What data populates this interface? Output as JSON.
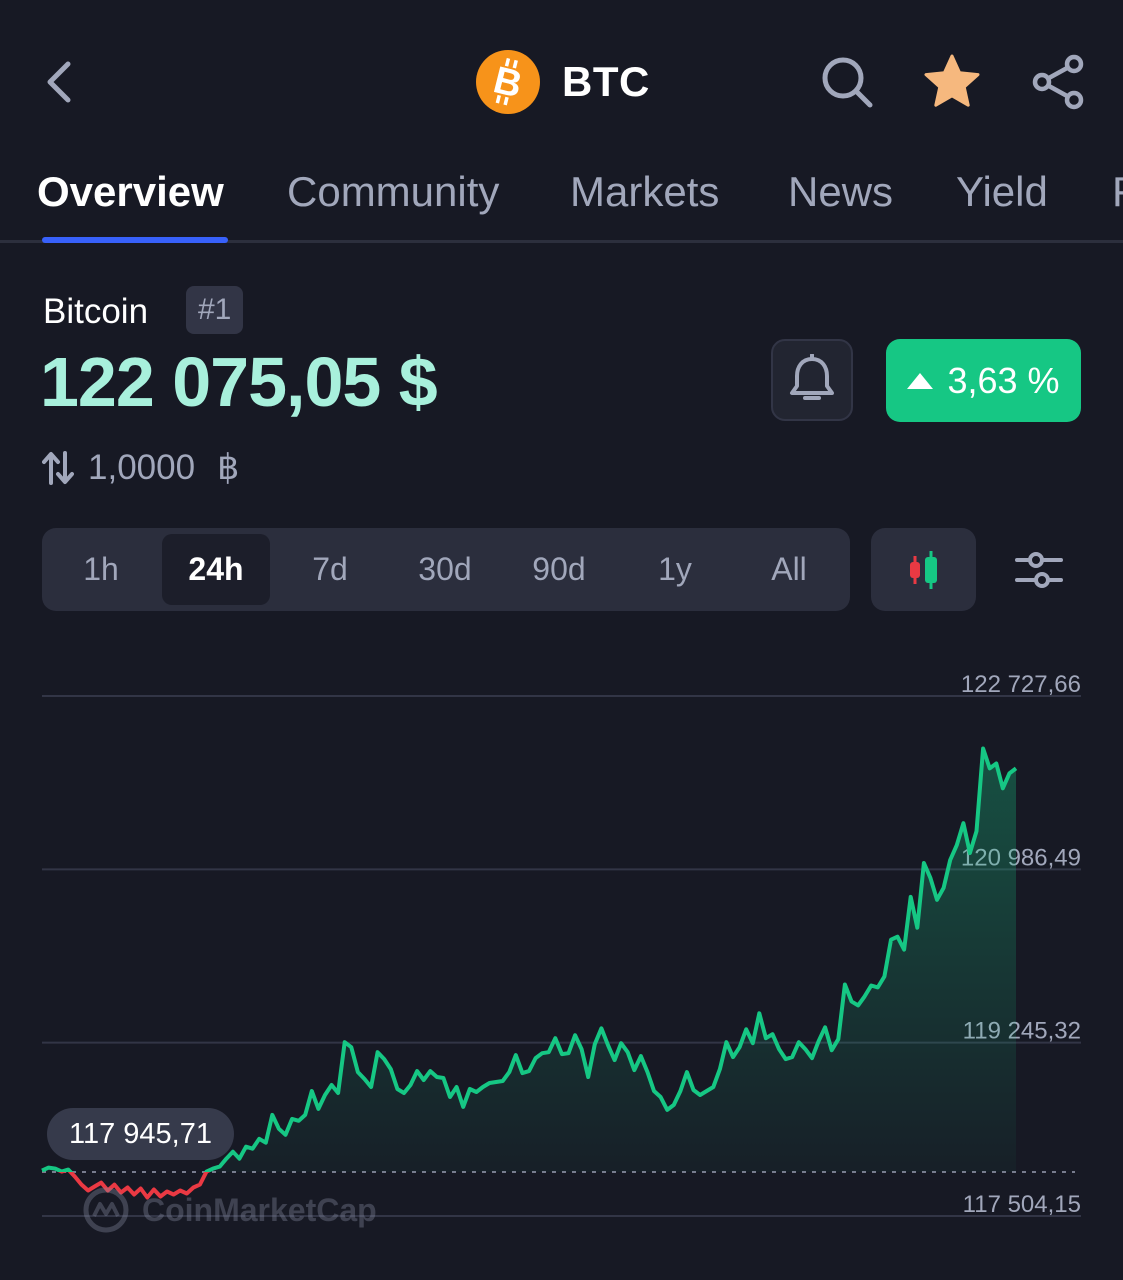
{
  "header": {
    "symbol": "BTC",
    "icons": {
      "back": "chevron-left-icon",
      "search": "search-icon",
      "favorite": "star-icon",
      "share": "share-icon"
    },
    "favorite_color": "#f6b87e",
    "logo_color": "#f7931a"
  },
  "tabs": [
    {
      "label": "Overview",
      "active": true
    },
    {
      "label": "Community",
      "active": false
    },
    {
      "label": "Markets",
      "active": false
    },
    {
      "label": "News",
      "active": false
    },
    {
      "label": "Yield",
      "active": false
    },
    {
      "label": "F",
      "active": false
    }
  ],
  "coin": {
    "name": "Bitcoin",
    "rank": "#1",
    "price": "122 075,05 $",
    "change": "3,63 %",
    "change_direction": "up",
    "change_color": "#16c784",
    "convert_amount": "1,0000",
    "convert_unit": "฿"
  },
  "ranges": [
    {
      "label": "1h",
      "active": false
    },
    {
      "label": "24h",
      "active": true
    },
    {
      "label": "7d",
      "active": false
    },
    {
      "label": "30d",
      "active": false
    },
    {
      "label": "90d",
      "active": false
    },
    {
      "label": "1y",
      "active": false
    },
    {
      "label": "All",
      "active": false
    }
  ],
  "chart": {
    "open_label": "117 945,71",
    "watermark": "CoinMarketCap"
  },
  "chart_data": {
    "type": "line",
    "title": "",
    "xlabel": "",
    "ylabel": "",
    "y_ticks": [
      "122 727,66",
      "120 986,49",
      "119 245,32",
      "117 504,15"
    ],
    "y_tick_values": [
      122727.66,
      120986.49,
      119245.32,
      117504.15
    ],
    "ylim": [
      117504.15,
      122727.66
    ],
    "baseline": 117945.71,
    "grid": true,
    "colors": {
      "up": "#16c784",
      "down": "#ea3943"
    },
    "series": [
      {
        "values": [
          117960,
          117990,
          117980,
          117950,
          117970,
          117900,
          117820,
          117760,
          117800,
          117840,
          117760,
          117820,
          117740,
          117790,
          117720,
          117780,
          117690,
          117770,
          117700,
          117750,
          117720,
          117760,
          117730,
          117790,
          117820,
          117950,
          117980,
          118000,
          118080,
          118150,
          118080,
          118200,
          118180,
          118280,
          118240,
          118520,
          118380,
          118320,
          118480,
          118460,
          118520,
          118760,
          118580,
          118720,
          118820,
          118740,
          119250,
          119200,
          118950,
          118880,
          118800,
          119150,
          119080,
          118980,
          118780,
          118740,
          118820,
          118960,
          118870,
          118960,
          118900,
          118890,
          118700,
          118800,
          118600,
          118780,
          118750,
          118800,
          118840,
          118850,
          118860,
          118950,
          119120,
          118940,
          118960,
          119090,
          119140,
          119150,
          119290,
          119130,
          119140,
          119320,
          119180,
          118900,
          119230,
          119390,
          119220,
          119070,
          119240,
          119150,
          118970,
          119110,
          118950,
          118760,
          118700,
          118570,
          118620,
          118760,
          118950,
          118770,
          118720,
          118760,
          118800,
          118980,
          119250,
          119100,
          119200,
          119380,
          119240,
          119540,
          119290,
          119330,
          119180,
          119080,
          119100,
          119250,
          119180,
          119090,
          119260,
          119400,
          119170,
          119280,
          119830,
          119660,
          119620,
          119710,
          119820,
          119800,
          119910,
          120280,
          120310,
          120180,
          120710,
          120400,
          121050,
          120900,
          120680,
          120800,
          121080,
          121230,
          121450,
          121150,
          121370,
          122200,
          122000,
          122050,
          121800,
          121950,
          122000
        ]
      }
    ]
  }
}
